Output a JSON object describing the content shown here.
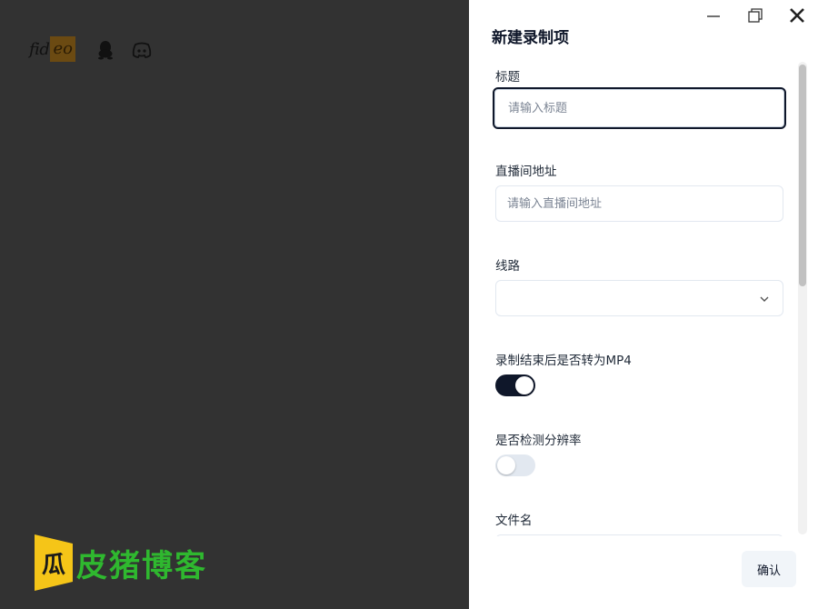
{
  "app": {
    "logo_text_left": "fid",
    "logo_text_right": "eo",
    "icons": [
      "qq-icon",
      "discord-icon"
    ]
  },
  "watermark": {
    "text": "皮猪博客",
    "badge_text": "瓜",
    "color": "#2fb82f",
    "badge_color": "#f5c518"
  },
  "drawer": {
    "title": "新建录制项",
    "window_controls": [
      "minimize-icon",
      "maximize-icon",
      "close-icon"
    ],
    "fields": {
      "title": {
        "label": "标题",
        "placeholder": "请输入标题",
        "value": ""
      },
      "room_url": {
        "label": "直播间地址",
        "placeholder": "请输入直播间地址",
        "value": ""
      },
      "line": {
        "label": "线路",
        "value": ""
      },
      "convert_mp4": {
        "label": "录制结束后是否转为MP4",
        "enabled": true
      },
      "detect_resolution": {
        "label": "是否检测分辨率",
        "enabled": false
      },
      "filename": {
        "label": "文件名"
      }
    },
    "confirm_label": "确认"
  },
  "colors": {
    "backdrop": "#323232",
    "primary": "#0f172a",
    "border": "#e2e8f0"
  }
}
